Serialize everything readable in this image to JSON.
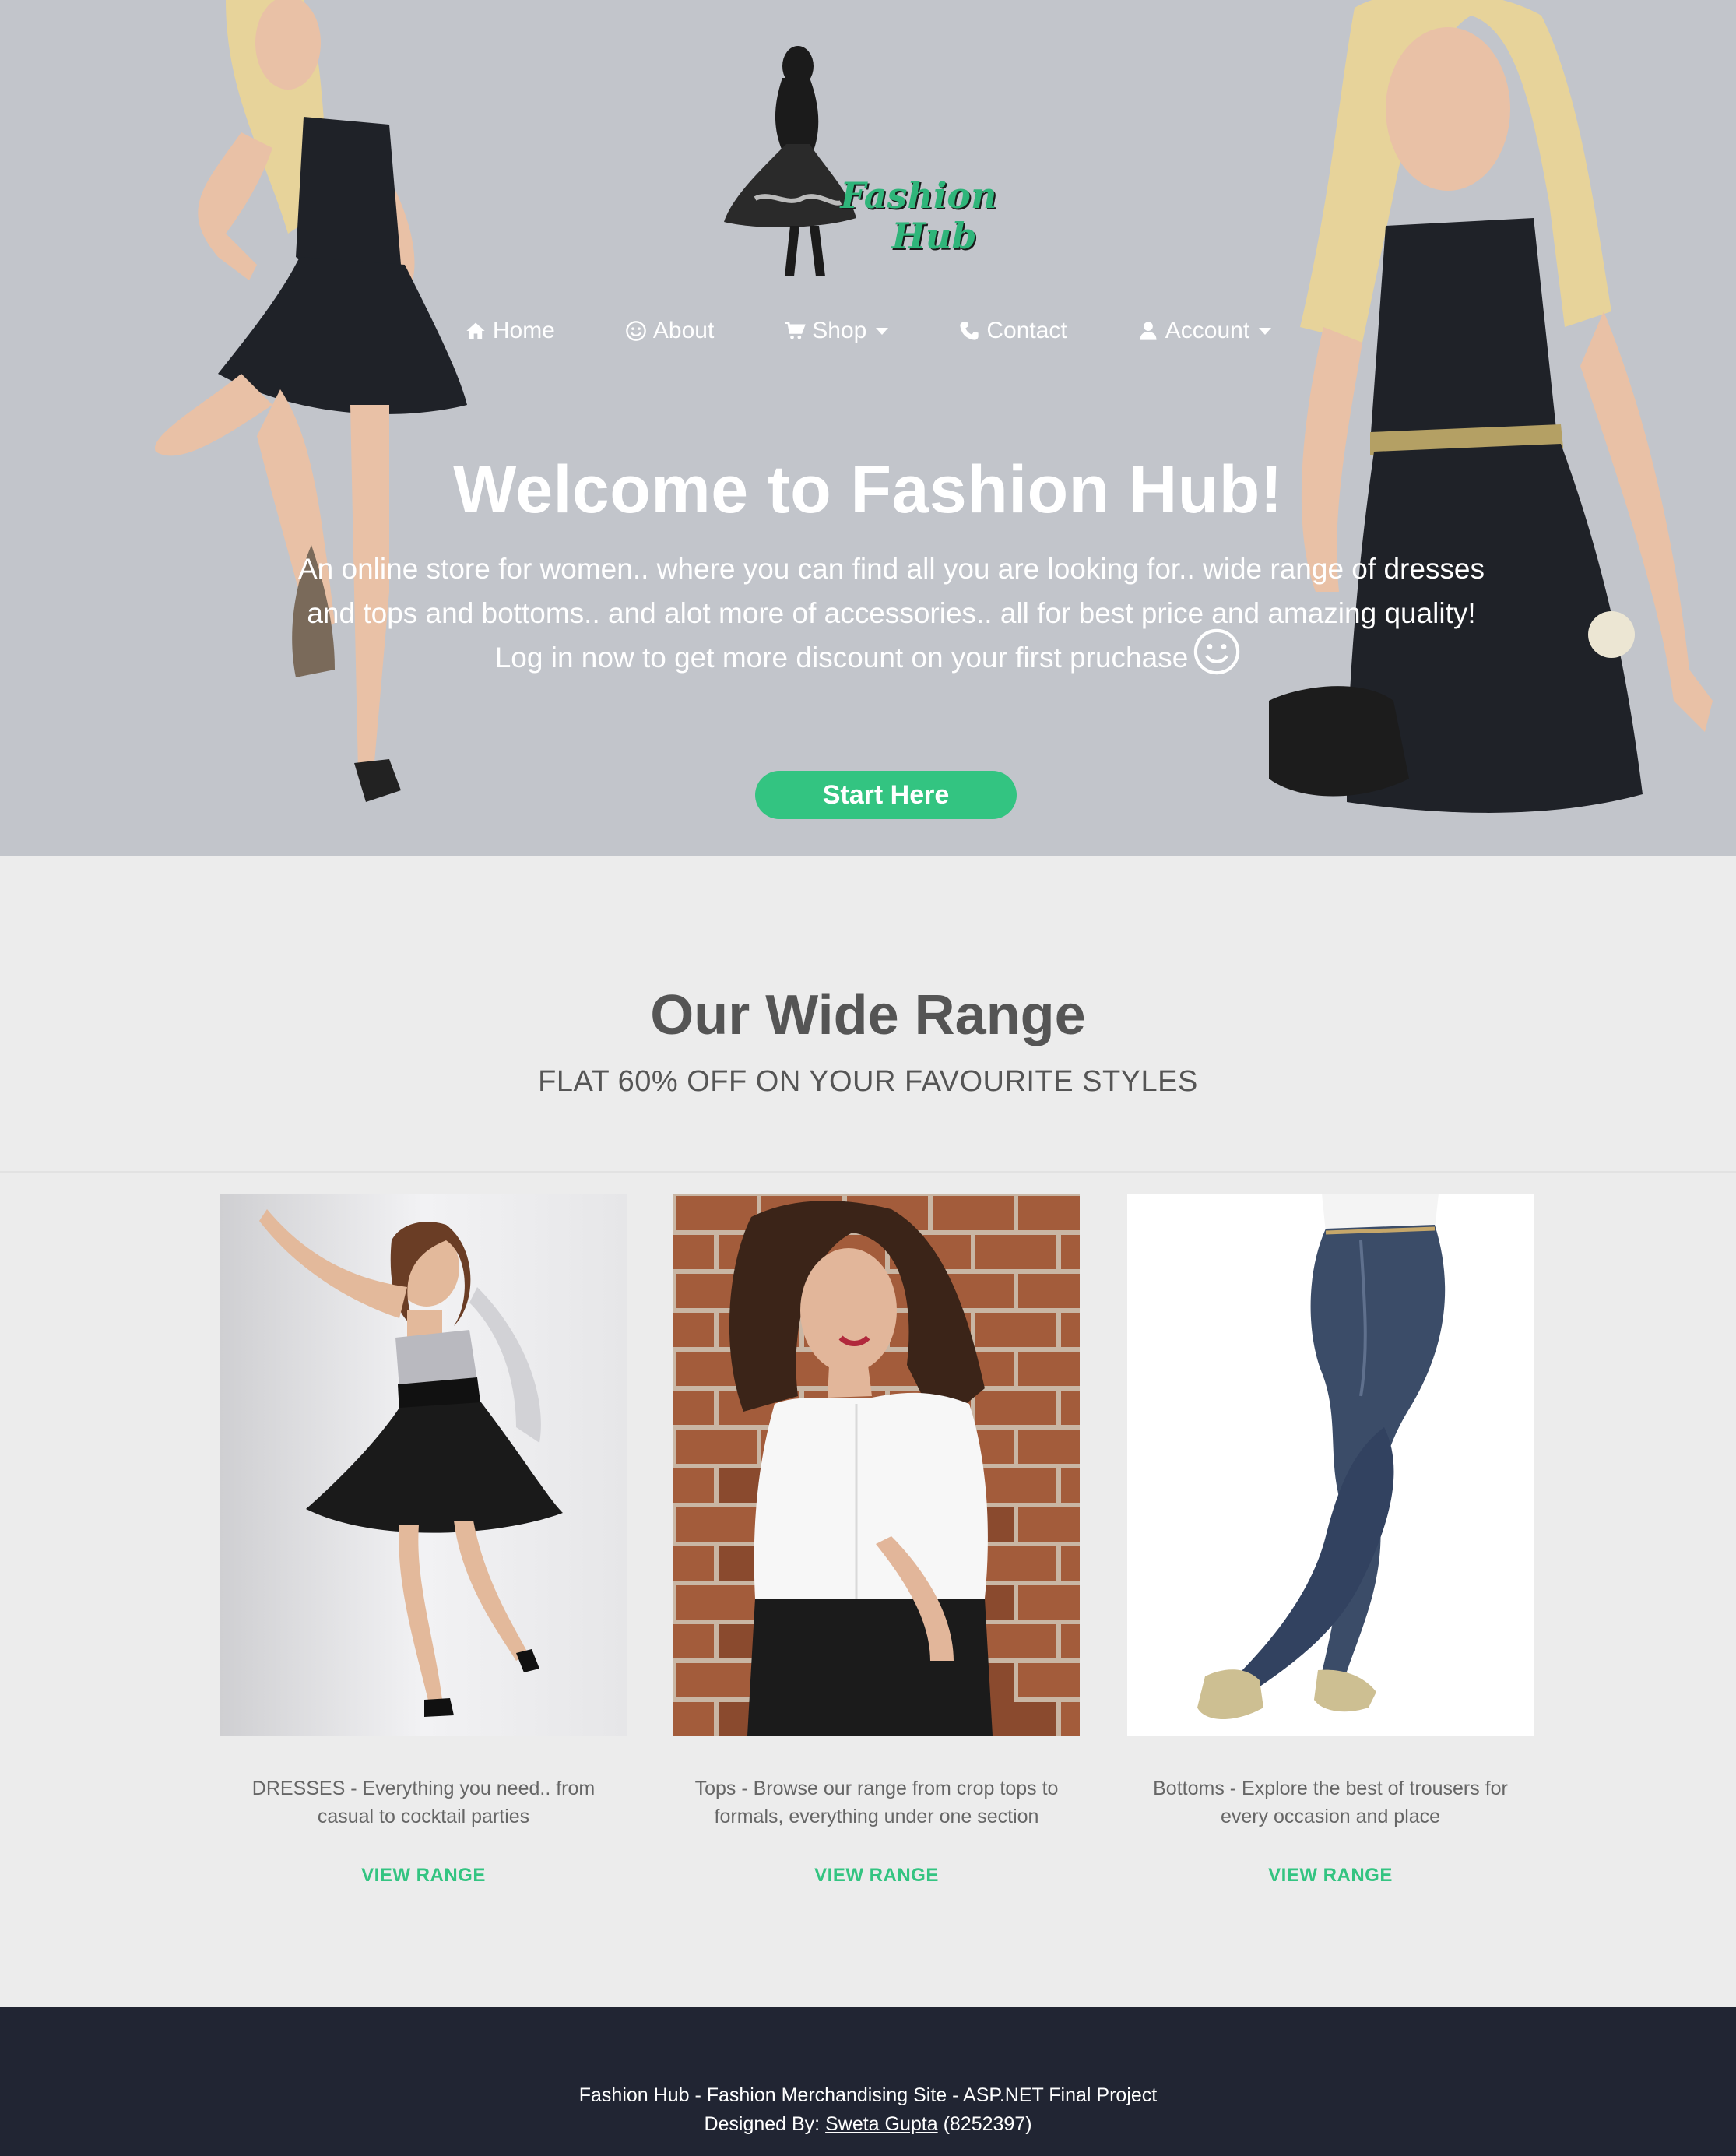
{
  "brand": {
    "logo_line1": "Fashion",
    "logo_line2": "Hub",
    "accent": "#33c481"
  },
  "nav": {
    "items": [
      {
        "label": "Home",
        "icon": "home-icon"
      },
      {
        "label": "About",
        "icon": "smile-icon"
      },
      {
        "label": "Shop",
        "icon": "cart-icon",
        "dropdown": true
      },
      {
        "label": "Contact",
        "icon": "phone-icon"
      },
      {
        "label": "Account",
        "icon": "user-icon",
        "dropdown": true
      }
    ]
  },
  "hero": {
    "title": "Welcome to Fashion Hub!",
    "text": "An online store for women.. where you can find all you are looking for.. wide range of dresses and tops and bottoms.. and alot more of accessories.. all for best price and amazing quality!",
    "login_text": "Log in now to get more discount on your first pruchase",
    "button": "Start Here"
  },
  "range": {
    "title": "Our Wide Range",
    "subtitle": "FLAT 60% OFF ON YOUR FAVOURITE STYLES",
    "cards": [
      {
        "desc": "DRESSES - Everything you need.. from casual to cocktail parties",
        "link": "VIEW RANGE"
      },
      {
        "desc": "Tops - Browse our range from crop tops to formals, everything under one section",
        "link": "VIEW RANGE"
      },
      {
        "desc": "Bottoms - Explore the best of trousers for every occasion and place",
        "link": "VIEW RANGE"
      }
    ]
  },
  "footer": {
    "line1": "Fashion Hub - Fashion Merchandising Site - ASP.NET Final Project",
    "designed_by": "Designed By:",
    "author": "Sweta Gupta",
    "author_id": "(8252397)"
  }
}
